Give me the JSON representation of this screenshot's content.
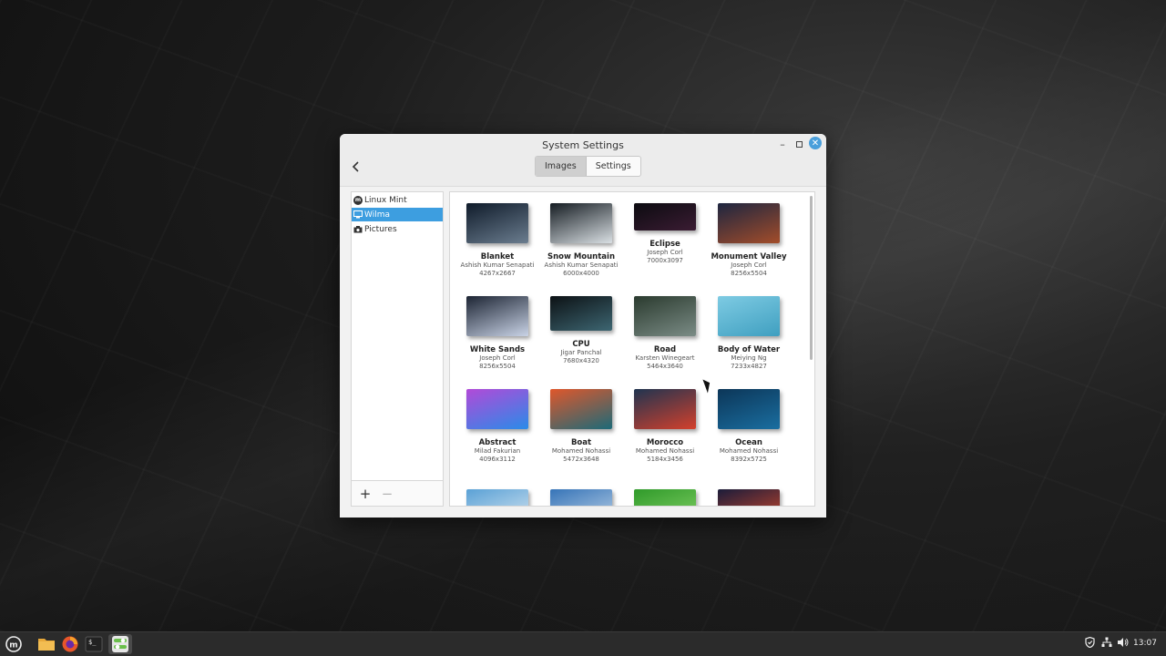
{
  "window": {
    "title": "System Settings",
    "tabs": [
      {
        "label": "Images",
        "active": true
      },
      {
        "label": "Settings",
        "active": false
      }
    ]
  },
  "sidebar": {
    "items": [
      {
        "label": "Linux Mint",
        "icon": "linux-mint-icon",
        "selected": false
      },
      {
        "label": "Wilma",
        "icon": "monitor-icon",
        "selected": true
      },
      {
        "label": "Pictures",
        "icon": "camera-icon",
        "selected": false
      }
    ],
    "add_label": "+",
    "remove_label": "−"
  },
  "wallpapers": [
    {
      "name": "Blanket",
      "author": "Ashish Kumar Senapati",
      "size": "4267x2667",
      "colors": [
        "#0f1b2a",
        "#6b7d8f"
      ]
    },
    {
      "name": "Snow Mountain",
      "author": "Ashish Kumar Senapati",
      "size": "6000x4000",
      "colors": [
        "#151c22",
        "#d9dfe3"
      ]
    },
    {
      "name": "Eclipse",
      "author": "Joseph Corl",
      "size": "7000x3097",
      "colors": [
        "#0b0b10",
        "#3b1c33"
      ]
    },
    {
      "name": "Monument Valley",
      "author": "Joseph Corl",
      "size": "8256x5504",
      "colors": [
        "#1d2540",
        "#a34d2a"
      ]
    },
    {
      "name": "White Sands",
      "author": "Joseph Corl",
      "size": "8256x5504",
      "colors": [
        "#1c2433",
        "#c9d3e6"
      ]
    },
    {
      "name": "CPU",
      "author": "Jigar Panchal",
      "size": "7680x4320",
      "colors": [
        "#0c1114",
        "#3d6672"
      ]
    },
    {
      "name": "Road",
      "author": "Karsten Winegeart",
      "size": "5464x3640",
      "colors": [
        "#2a3a2e",
        "#7b8c86"
      ]
    },
    {
      "name": "Body of Water",
      "author": "Meiying Ng",
      "size": "7233x4827",
      "colors": [
        "#7ecbe3",
        "#3f9fc0"
      ]
    },
    {
      "name": "Abstract",
      "author": "Milad Fakurian",
      "size": "4096x3112",
      "colors": [
        "#b24ad8",
        "#2a8be8"
      ]
    },
    {
      "name": "Boat",
      "author": "Mohamed Nohassi",
      "size": "5472x3648",
      "colors": [
        "#e0572b",
        "#1c6a78"
      ]
    },
    {
      "name": "Morocco",
      "author": "Mohamed Nohassi",
      "size": "5184x3456",
      "colors": [
        "#1f3450",
        "#d4402c"
      ]
    },
    {
      "name": "Ocean",
      "author": "Mohamed Nohassi",
      "size": "8392x5725",
      "colors": [
        "#0c3658",
        "#1a6ea0"
      ]
    },
    {
      "name": "",
      "author": "",
      "size": "",
      "colors": [
        "#5aa1d6",
        "#dfeaf2"
      ]
    },
    {
      "name": "",
      "author": "",
      "size": "",
      "colors": [
        "#3674b8",
        "#c7d9ea"
      ]
    },
    {
      "name": "",
      "author": "",
      "size": "",
      "colors": [
        "#2f9a2a",
        "#8ad46a"
      ]
    },
    {
      "name": "",
      "author": "",
      "size": "",
      "colors": [
        "#1b1c3a",
        "#d94a2a"
      ]
    }
  ],
  "taskbar": {
    "clock": "13:07",
    "apps": [
      "menu-icon",
      "files-icon",
      "firefox-icon",
      "terminal-icon",
      "system-settings-icon"
    ],
    "tray": [
      "shield-icon",
      "network-icon",
      "volume-icon"
    ]
  }
}
